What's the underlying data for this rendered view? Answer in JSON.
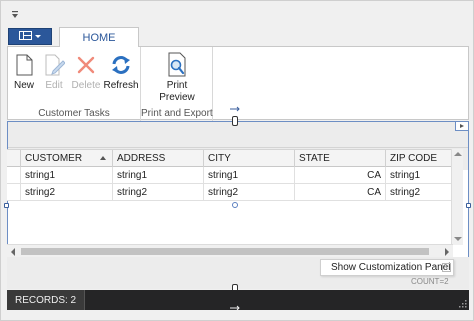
{
  "ribbon": {
    "tab_home": "HOME",
    "groups": [
      {
        "label": "Customer Tasks"
      },
      {
        "label": "Print and Export"
      }
    ],
    "buttons": {
      "new": "New",
      "edit": "Edit",
      "delete": "Delete",
      "refresh": "Refresh",
      "print_preview_1": "Print",
      "print_preview_2": "Preview"
    }
  },
  "grid": {
    "columns": [
      "CUSTOMER",
      "ADDRESS",
      "CITY",
      "STATE",
      "ZIP CODE"
    ],
    "sorted_column": "CUSTOMER",
    "rows": [
      [
        "string1",
        "string1",
        "string1",
        "CA",
        "string1"
      ],
      [
        "string2",
        "string2",
        "string2",
        "CA",
        "string2"
      ]
    ]
  },
  "customization": {
    "panel_label": "Show Customization Panel"
  },
  "footer": {
    "count_ghost": "COUNT=2"
  },
  "status": {
    "records": "RECORDS: 2"
  },
  "colors": {
    "accent": "#2b579a",
    "selection_frame": "#6d8ec4",
    "status_bar": "#252526"
  }
}
